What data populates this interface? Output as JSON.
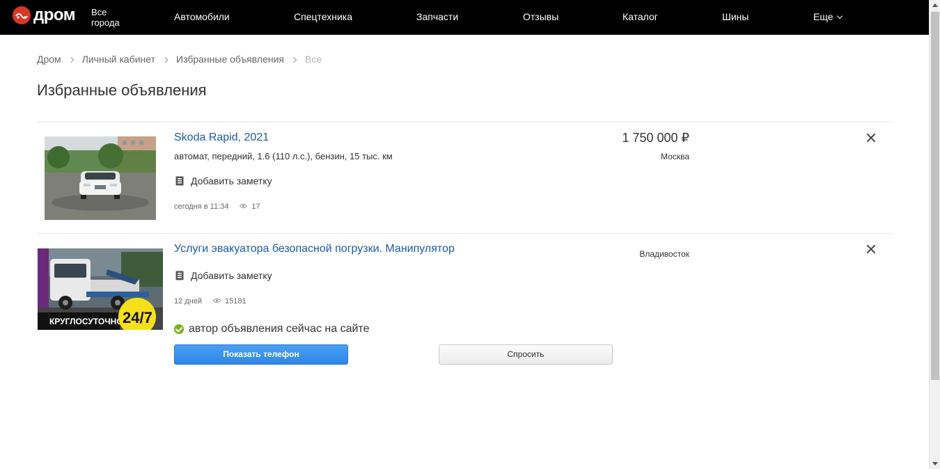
{
  "header": {
    "logo_text": "дром",
    "city": "Все города",
    "nav": [
      {
        "label": "Автомобили"
      },
      {
        "label": "Спецтехника"
      },
      {
        "label": "Запчасти"
      },
      {
        "label": "Отзывы"
      },
      {
        "label": "Каталог"
      },
      {
        "label": "Шины"
      },
      {
        "label": "Еще"
      }
    ]
  },
  "breadcrumb": [
    "Дром",
    "Личный кабинет",
    "Избранные объявления",
    "Все"
  ],
  "page_title": "Избранные объявления",
  "listings": [
    {
      "title": "Skoda Rapid, 2021",
      "specs": "автомат, передний, 1.6 (110 л.с.), бензин, 15 тыс. км",
      "note_label": "Добавить заметку",
      "date": "сегодня в 11:34",
      "views": "17",
      "price": "1 750 000 ₽",
      "location": "Москва"
    },
    {
      "title": "Услуги эвакуатора безопасной погрузки. Манипулятор",
      "note_label": "Добавить заметку",
      "date": "12 дней",
      "views": "15181",
      "location": "Владивосток",
      "online_status": "автор объявления сейчас на сайте",
      "show_phone_label": "Показать телефон",
      "ask_label": "Спросить",
      "thumb_caption": "КРУГЛОСУТОЧНО",
      "thumb_badge": "24/7"
    }
  ],
  "colors": {
    "header_bg": "#000000",
    "brand_red": "#db3727",
    "link_blue": "#1a5aa7",
    "button_blue": "#2f86e6",
    "online_green": "#7bb31a"
  }
}
